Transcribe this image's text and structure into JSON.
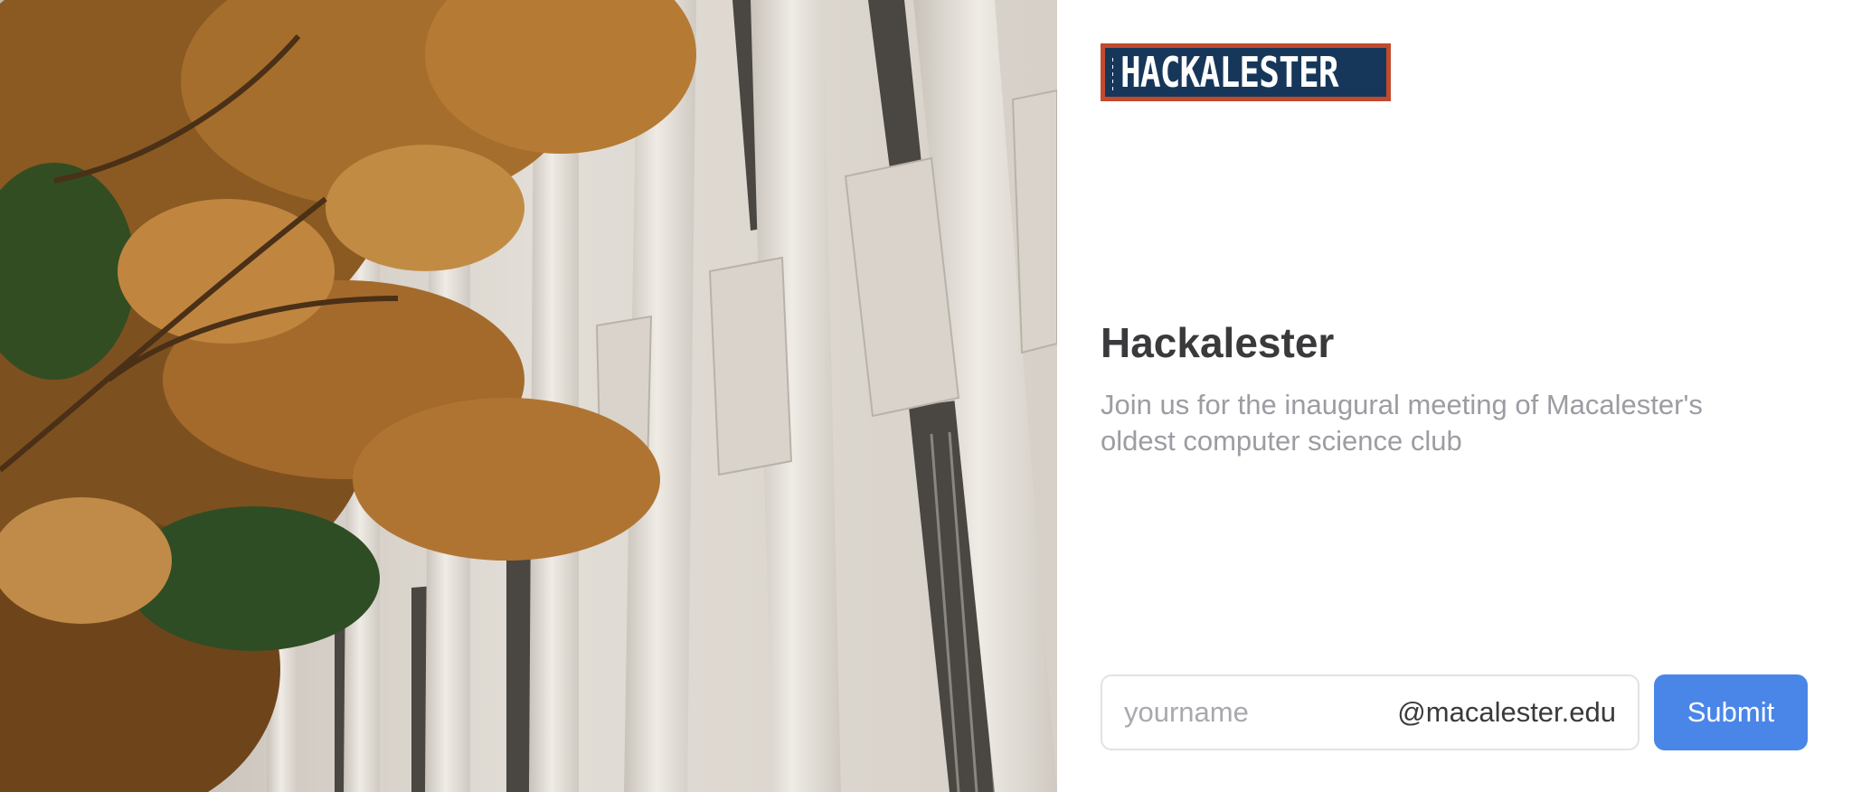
{
  "logo": {
    "text": "HACKALESTER"
  },
  "hero": {
    "image_alt": "Autumn tree beside a concrete campus building"
  },
  "page": {
    "title": "Hackalester",
    "subtitle": "Join us for the inaugural meeting of Macalester's oldest computer science club"
  },
  "form": {
    "email_placeholder": "yourname",
    "email_suffix": "@macalester.edu",
    "submit_label": "Submit"
  },
  "colors": {
    "logo_border": "#c24a2e",
    "logo_background": "#16375a",
    "submit_button": "#4a86e8",
    "title_text": "#3a3a3c",
    "subtitle_text": "#9c9ca3"
  }
}
